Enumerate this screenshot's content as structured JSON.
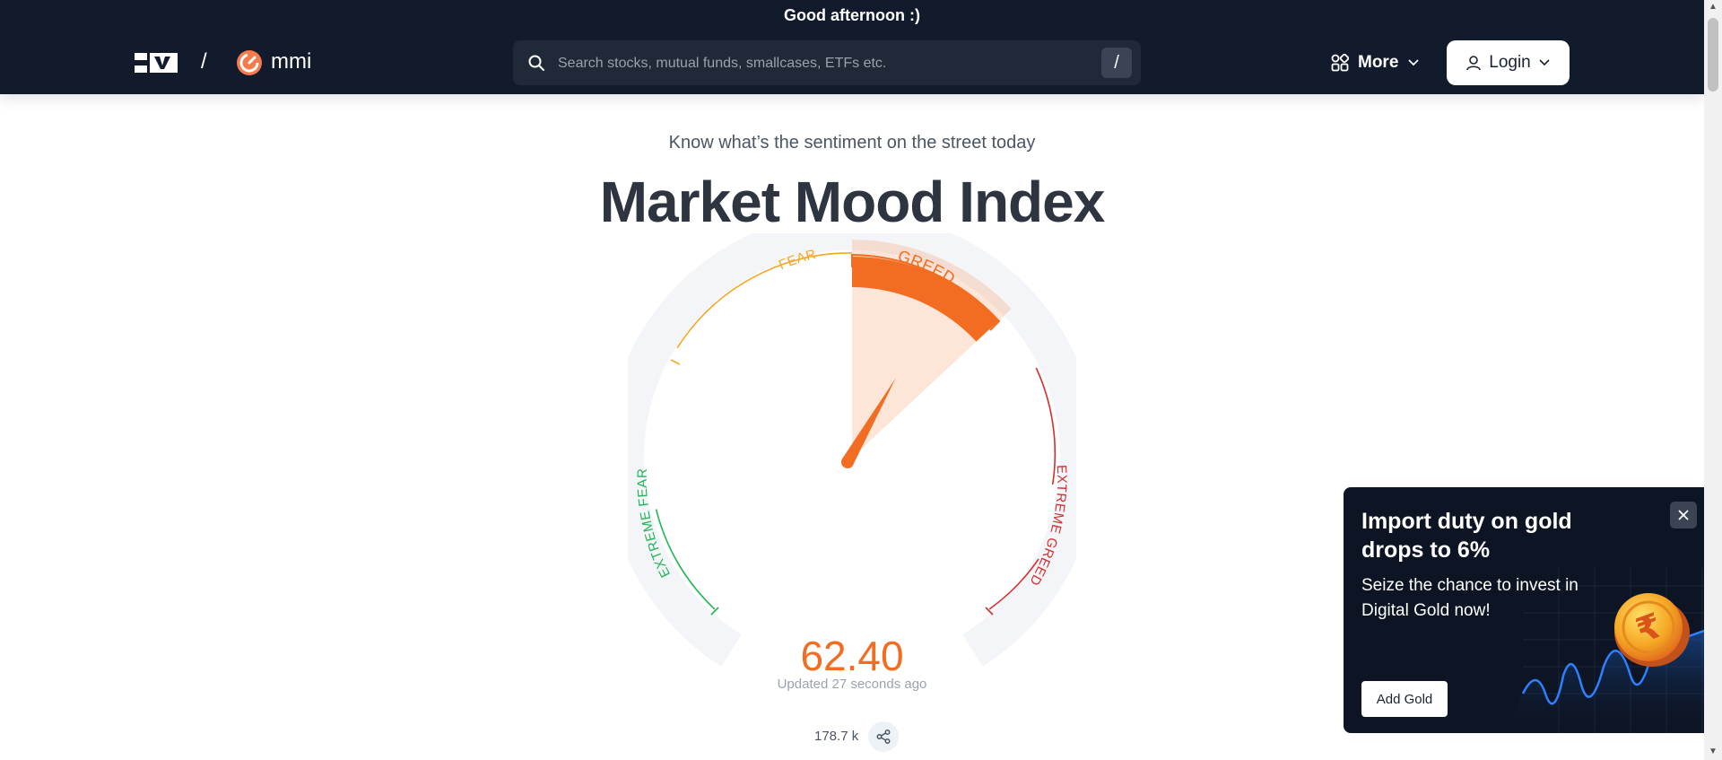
{
  "greeting": "Good afternoon :)",
  "nav": {
    "brand": "mmi",
    "separator": "/",
    "search_placeholder": "Search stocks, mutual funds, smallcases, ETFs etc.",
    "search_shortcut": "/",
    "more_label": "More",
    "login_label": "Login"
  },
  "hero": {
    "subtitle": "Know what’s the sentiment on the street today",
    "title": "Market Mood Index"
  },
  "gauge": {
    "value": "62.40",
    "value_numeric": 62.4,
    "min": 0,
    "max": 100,
    "updated": "Updated 27 seconds ago",
    "zones": {
      "extreme_fear": "EXTREME FEAR",
      "fear": "FEAR",
      "greed": "GREED",
      "extreme_greed": "EXTREME GREED"
    },
    "zone_colors": {
      "extreme_fear": "#22b455",
      "fear": "#f5a623",
      "greed": "#f26d21",
      "extreme_greed": "#d32f2f"
    },
    "active_zone": "greed"
  },
  "meta": {
    "views": "178.7 k"
  },
  "promo": {
    "title": "Import duty on gold drops to 6%",
    "subtitle": "Seize the chance to invest in Digital Gold now!",
    "cta": "Add Gold",
    "coin_symbol": "₹"
  },
  "colors": {
    "nav_bg": "#111b2b",
    "accent": "#f26d21",
    "title_text": "#2e3440"
  },
  "icons": {
    "search": "search-icon",
    "more": "apps-icon",
    "login": "user-icon",
    "share": "share-icon",
    "close": "close-icon"
  }
}
